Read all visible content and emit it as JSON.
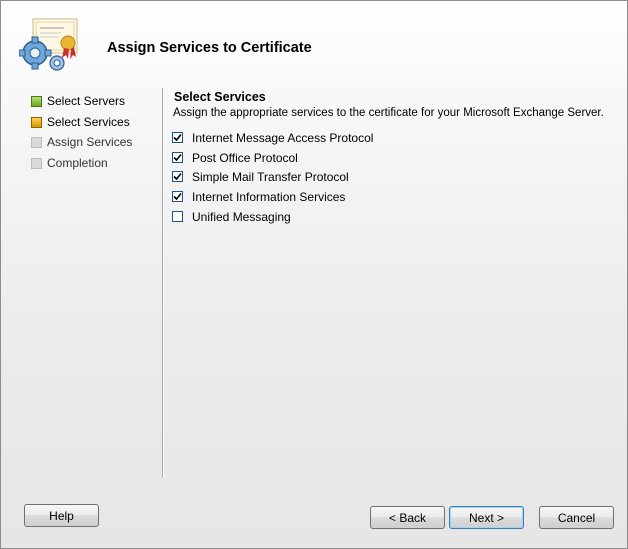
{
  "header": {
    "title": "Assign Services to Certificate",
    "icon": "certificate-gear-icon"
  },
  "steps": [
    {
      "label": "Select Servers",
      "state": "done"
    },
    {
      "label": "Select Services",
      "state": "current"
    },
    {
      "label": "Assign Services",
      "state": "pending"
    },
    {
      "label": "Completion",
      "state": "pending"
    }
  ],
  "content": {
    "title": "Select Services",
    "description": "Assign the appropriate services to the certificate for your Microsoft Exchange Server.",
    "services": [
      {
        "label": "Internet Message Access Protocol",
        "checked": true
      },
      {
        "label": "Post Office Protocol",
        "checked": true
      },
      {
        "label": "Simple Mail Transfer Protocol",
        "checked": true
      },
      {
        "label": "Internet Information Services",
        "checked": true
      },
      {
        "label": "Unified Messaging",
        "checked": false
      }
    ]
  },
  "buttons": {
    "help": "Help",
    "back": "< Back",
    "next": "Next >",
    "cancel": "Cancel"
  },
  "colors": {
    "step_done": "#6ea82a",
    "step_current": "#d79a00",
    "step_pending": "#d9d9d9",
    "checkbox_border": "#1c5180"
  }
}
